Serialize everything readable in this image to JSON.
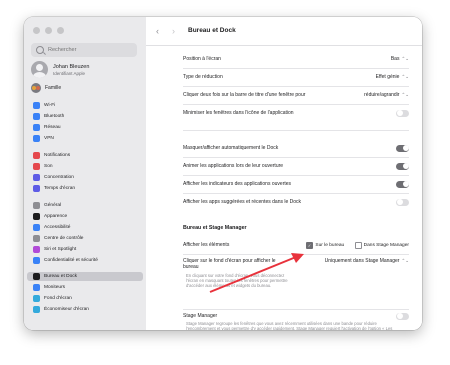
{
  "sidebar": {
    "search_placeholder": "Rechercher",
    "user_name": "Johan Bleuzen",
    "user_sub": "Identifiant Apple",
    "family": "Famille",
    "items": [
      {
        "label": "Wi-Fi",
        "color": "#3a82f7"
      },
      {
        "label": "Bluetooth",
        "color": "#3a82f7"
      },
      {
        "label": "Réseau",
        "color": "#3a82f7"
      },
      {
        "label": "VPN",
        "color": "#3a82f7"
      },
      {
        "label": "Notifications",
        "color": "#e5484d"
      },
      {
        "label": "Son",
        "color": "#e5484d"
      },
      {
        "label": "Concentration",
        "color": "#5e5ce6"
      },
      {
        "label": "Temps d'écran",
        "color": "#5e5ce6"
      },
      {
        "label": "Général",
        "color": "#8e8e93"
      },
      {
        "label": "Apparence",
        "color": "#1d1d1f"
      },
      {
        "label": "Accessibilité",
        "color": "#3a82f7"
      },
      {
        "label": "Centre de contrôle",
        "color": "#8e8e93"
      },
      {
        "label": "Siri et Spotlight",
        "color": "#b14bd8"
      },
      {
        "label": "Confidentialité et sécurité",
        "color": "#3a82f7"
      },
      {
        "label": "Bureau et Dock",
        "color": "#1d1d1f"
      },
      {
        "label": "Moniteurs",
        "color": "#3a82f7"
      },
      {
        "label": "Fond d'écran",
        "color": "#34aadc"
      },
      {
        "label": "Économiseur d'écran",
        "color": "#34aadc"
      }
    ]
  },
  "header": {
    "back": "‹",
    "forward": "›",
    "title": "Bureau et Dock"
  },
  "dock": {
    "position_label": "Position à l'écran",
    "position_value": "Bas",
    "effect_label": "Type de réduction",
    "effect_value": "Effet génie",
    "dblclick_label": "Cliquer deux fois sur la barre de titre d'une fenêtre pour",
    "dblclick_value": "réduire/agrandir",
    "minimize_label": "Minimiser les fenêtres dans l'icône de l'application",
    "minimize_on": false,
    "autohide_label": "Masquer/afficher automatiquement le Dock",
    "autohide_on": true,
    "animate_label": "Animer les applications lors de leur ouverture",
    "animate_on": true,
    "indicators_label": "Afficher les indicateurs des applications ouvertes",
    "indicators_on": true,
    "suggested_label": "Afficher les apps suggérées et récentes dans le Dock",
    "suggested_on": false
  },
  "desktop": {
    "section_title": "Bureau et Stage Manager",
    "show_items_label": "Afficher les éléments",
    "on_desktop_label": "Sur le bureau",
    "on_desktop_checked": true,
    "in_stage_label": "Dans Stage Manager",
    "in_stage_checked": false,
    "click_label": "Cliquer sur le fond d'écran pour afficher le bureau",
    "click_value": "Uniquement dans Stage Manager",
    "click_desc": "En cliquant sur votre fond d'écran, vous déconnectez l'écran en masquant toutes les fenêtres pour permettre d'accéder aux éléments et widgets du bureau.",
    "stage_label": "Stage Manager",
    "stage_on": false,
    "stage_desc": "Stage Manager regroupe les fenêtres que vous avez récemment utilisées dans une bande pour réduire l'encombrement et vous permettre d'y accéder rapidement. Stage Manager requiert l'activation de l'option « Les fenêtres disposent de Spaces"
  },
  "colors": {
    "annotation_arrow": "#e8323c"
  }
}
